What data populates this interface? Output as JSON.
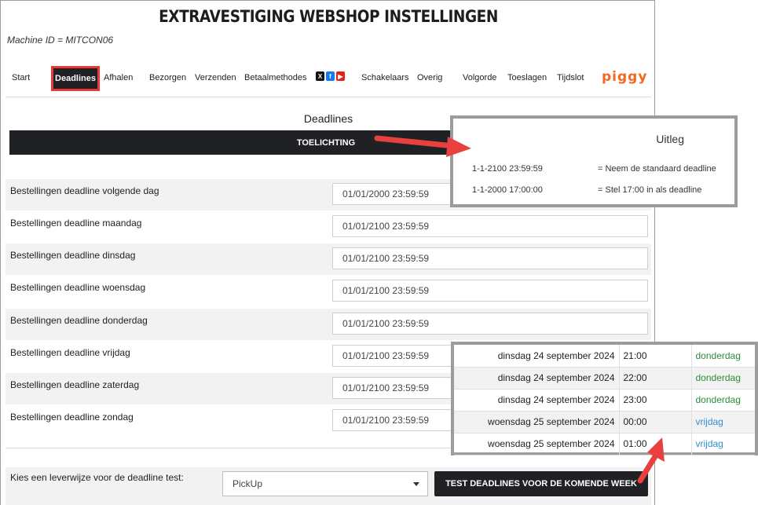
{
  "page": {
    "title": "EXTRAVESTIGING WEBSHOP INSTELLINGEN",
    "machine_id": "Machine ID = MITCON06"
  },
  "nav": {
    "items": [
      "Start",
      "Deadlines",
      "Afhalen",
      "Bezorgen",
      "Verzenden",
      "Betaalmethodes",
      "Schakelaars",
      "Overig",
      "Volgorde",
      "Toeslagen",
      "Tijdslot"
    ],
    "active": "Deadlines",
    "social_icons": [
      "x-icon",
      "facebook-icon",
      "youtube-icon"
    ],
    "brand": "piggy"
  },
  "deadlines": {
    "section_title": "Deadlines",
    "toelichting_label": "TOELICHTING",
    "rows": [
      {
        "label": "Bestellingen deadline volgende dag",
        "value": "01/01/2000 23:59:59"
      },
      {
        "label": "Bestellingen deadline maandag",
        "value": "01/01/2100 23:59:59"
      },
      {
        "label": "Bestellingen deadline dinsdag",
        "value": "01/01/2100 23:59:59"
      },
      {
        "label": "Bestellingen deadline woensdag",
        "value": "01/01/2100 23:59:59"
      },
      {
        "label": "Bestellingen deadline donderdag",
        "value": "01/01/2100 23:59:59"
      },
      {
        "label": "Bestellingen deadline vrijdag",
        "value": "01/01/2100 23:59:59"
      },
      {
        "label": "Bestellingen deadline zaterdag",
        "value": "01/01/2100 23:59:59"
      },
      {
        "label": "Bestellingen deadline zondag",
        "value": "01/01/2100 23:59:59"
      }
    ]
  },
  "test": {
    "label": "Kies een leverwijze voor de deadline test:",
    "select_value": "PickUp",
    "button_label": "TEST DEADLINES VOOR DE KOMENDE WEEK"
  },
  "uitleg": {
    "title": "Uitleg",
    "entries": [
      {
        "key": "1-1-2100 23:59:59",
        "desc": "= Neem de standaard deadline"
      },
      {
        "key": "1-1-2000 17:00:00",
        "desc": "= Stel 17:00 in als deadline"
      }
    ]
  },
  "test_results": [
    {
      "date": "dinsdag 24 september 2024",
      "time": "21:00",
      "day": "donderdag"
    },
    {
      "date": "dinsdag 24 september 2024",
      "time": "22:00",
      "day": "donderdag"
    },
    {
      "date": "dinsdag 24 september 2024",
      "time": "23:00",
      "day": "donderdag"
    },
    {
      "date": "woensdag 25 september 2024",
      "time": "00:00",
      "day": "vrijdag"
    },
    {
      "date": "woensdag 25 september 2024",
      "time": "01:00",
      "day": "vrijdag"
    }
  ],
  "colors": {
    "dark_button": "#1f2125",
    "highlight_red": "#e43a3a",
    "green_day": "#2e8b3a",
    "blue_day": "#2f8fd1",
    "brand_orange": "#f26722"
  }
}
